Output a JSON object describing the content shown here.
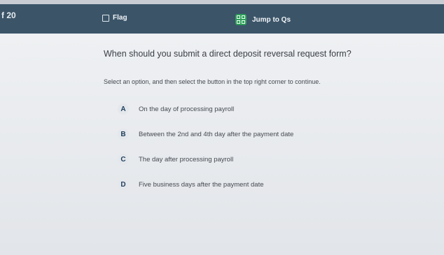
{
  "header": {
    "question_counter": "f 20",
    "flag_label": "Flag",
    "jump_label": "Jump to Qs",
    "jump_icon_color": "#2f9e5a",
    "bar_color": "#3b5468"
  },
  "question": {
    "text": "When should you submit a direct deposit reversal request form?",
    "instruction": "Select an option, and then select the button in the top right corner to continue."
  },
  "options": [
    {
      "letter": "A",
      "text": "On the day of processing payroll"
    },
    {
      "letter": "B",
      "text": "Between the 2nd and 4th day after the payment date"
    },
    {
      "letter": "C",
      "text": "The day after processing payroll"
    },
    {
      "letter": "D",
      "text": "Five business days after the payment date"
    }
  ]
}
